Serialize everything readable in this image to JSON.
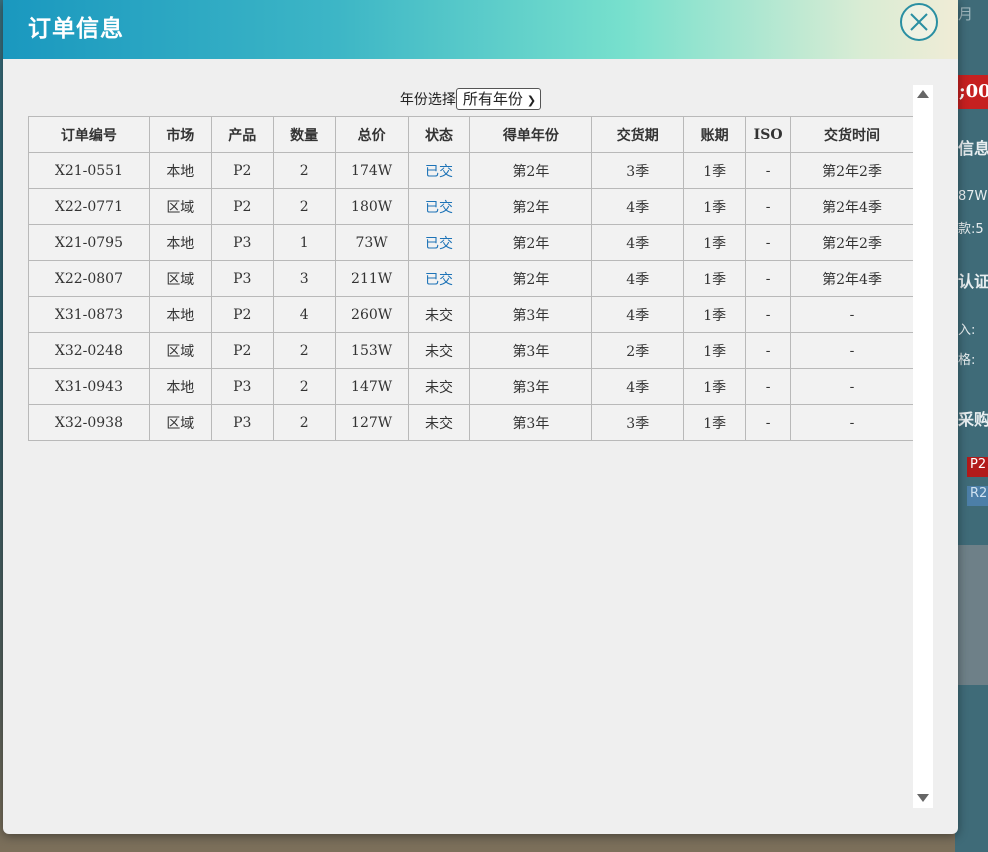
{
  "modal": {
    "title": "订单信息",
    "year_label": "年份选择",
    "year_selected": "所有年份"
  },
  "table": {
    "headers": [
      "订单编号",
      "市场",
      "产品",
      "数量",
      "总价",
      "状态",
      "得单年份",
      "交货期",
      "账期",
      "ISO",
      "交货时间"
    ],
    "rows": [
      [
        "X21-0551",
        "本地",
        "P2",
        "2",
        "174W",
        "已交",
        "第2年",
        "3季",
        "1季",
        "-",
        "第2年2季"
      ],
      [
        "X22-0771",
        "区域",
        "P2",
        "2",
        "180W",
        "已交",
        "第2年",
        "4季",
        "1季",
        "-",
        "第2年4季"
      ],
      [
        "X21-0795",
        "本地",
        "P3",
        "1",
        "73W",
        "已交",
        "第2年",
        "4季",
        "1季",
        "-",
        "第2年2季"
      ],
      [
        "X22-0807",
        "区域",
        "P3",
        "3",
        "211W",
        "已交",
        "第2年",
        "4季",
        "1季",
        "-",
        "第2年4季"
      ],
      [
        "X31-0873",
        "本地",
        "P2",
        "4",
        "260W",
        "未交",
        "第3年",
        "4季",
        "1季",
        "-",
        "-"
      ],
      [
        "X32-0248",
        "区域",
        "P2",
        "2",
        "153W",
        "未交",
        "第3年",
        "2季",
        "1季",
        "-",
        "-"
      ],
      [
        "X31-0943",
        "本地",
        "P3",
        "2",
        "147W",
        "未交",
        "第3年",
        "4季",
        "1季",
        "-",
        "-"
      ],
      [
        "X32-0938",
        "区域",
        "P3",
        "2",
        "127W",
        "未交",
        "第3年",
        "3季",
        "1季",
        "-",
        "-"
      ]
    ]
  },
  "background": {
    "items": [
      "月",
      "信息",
      "87W",
      "款:5",
      "认证",
      "入:",
      "格:",
      "采购"
    ],
    "badges": [
      "P2",
      "R2"
    ],
    "strip": "00"
  },
  "colors": {
    "status_done": "#1d73b7",
    "header_gradient_start": "#1a98bf",
    "header_gradient_end": "#f0ecd6"
  }
}
